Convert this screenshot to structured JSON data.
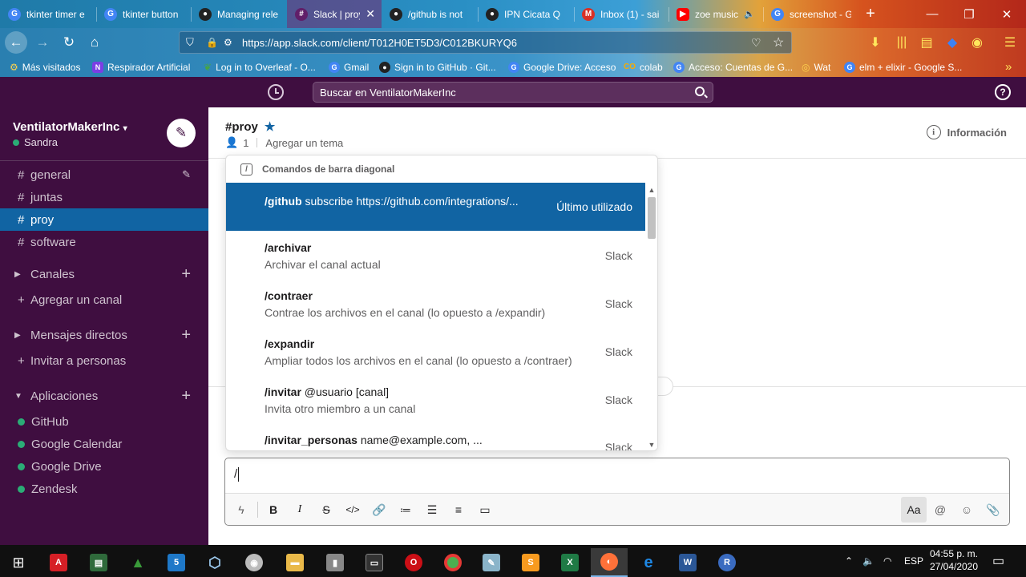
{
  "browser": {
    "tabs": [
      {
        "title": "tkinter timer e",
        "icon": "google-icon",
        "color": "#4285f4"
      },
      {
        "title": "tkinter button",
        "icon": "google-icon",
        "color": "#4285f4"
      },
      {
        "title": "Managing rele",
        "icon": "github-icon",
        "color": "#222222"
      },
      {
        "title": "Slack | proy",
        "icon": "slack-icon",
        "color": "#611f69"
      },
      {
        "title": "/github is not",
        "icon": "github-icon",
        "color": "#222222"
      },
      {
        "title": "IPN Cicata Q",
        "icon": "github-icon",
        "color": "#222222"
      },
      {
        "title": "Inbox (1) - sai",
        "icon": "gmail-icon",
        "color": "#d93025"
      },
      {
        "title": "zoe music",
        "icon": "youtube-icon",
        "color": "#ff0000"
      },
      {
        "title": "screenshot - G",
        "icon": "google-icon",
        "color": "#4285f4"
      }
    ],
    "url": "https://app.slack.com/client/T012H0ET5D3/C012BKURYQ6",
    "bookmarks": [
      "Más visitados",
      "Respirador Artificial",
      "Log in to Overleaf - O...",
      "Gmail",
      "Sign in to GitHub · Git...",
      "Google Drive: Acceso",
      "colab",
      "Acceso: Cuentas de G...",
      "Wat",
      "elm + elixir - Google S..."
    ]
  },
  "search": {
    "placeholder": "Buscar en VentilatorMakerInc"
  },
  "sidebar": {
    "workspace": "VentilatorMakerInc",
    "user": "Sandra",
    "channels": [
      "general",
      "juntas",
      "proy",
      "software"
    ],
    "sections": {
      "channels": "Canales",
      "add_channel": "Agregar un canal",
      "direct": "Mensajes directos",
      "invite": "Invitar a personas",
      "apps": "Aplicaciones"
    },
    "apps": [
      "GitHub",
      "Google Calendar",
      "Google Drive",
      "Zendesk"
    ]
  },
  "channel": {
    "name": "#proy",
    "members": "1",
    "topic": "Agregar un tema",
    "info": "Información"
  },
  "popup": {
    "header": "Comandos de barra diagonal",
    "commands": [
      {
        "name": "/github",
        "args": "subscribe https://github.com/integrations/...",
        "desc": "",
        "source": "Último utilizado"
      },
      {
        "name": "/archivar",
        "args": "",
        "desc": "Archivar el canal actual",
        "source": "Slack"
      },
      {
        "name": "/contraer",
        "args": "",
        "desc": "Contrae los archivos en el canal (lo opuesto a /expandir)",
        "source": "Slack"
      },
      {
        "name": "/expandir",
        "args": "",
        "desc": "Ampliar todos los archivos en el canal (lo opuesto a /contraer)",
        "source": "Slack"
      },
      {
        "name": "/invitar",
        "args": "@usuario [canal]",
        "desc": "Invita otro miembro a un canal",
        "source": "Slack"
      },
      {
        "name": "/invitar_personas",
        "args": "name@example.com, ...",
        "desc": "",
        "source": "Slack"
      }
    ]
  },
  "composer": {
    "value": "/"
  },
  "taskbar": {
    "lang": "ESP",
    "time": "04:55 p. m.",
    "date": "27/04/2020"
  },
  "colors": {
    "slack_purple": "#3f0e40",
    "active_blue": "#1164a3",
    "online_green": "#2bac76"
  }
}
